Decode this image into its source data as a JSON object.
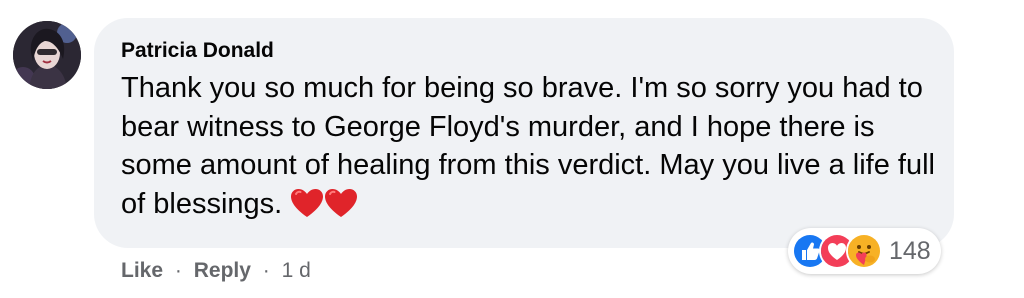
{
  "comment": {
    "author": "Patricia Donald",
    "text": "Thank you so much for being so brave. I'm so sorry you had to bear witness to George Floyd's murder, and I hope there is some amount of healing from this verdict. May you live a life full of blessings.",
    "emojis": [
      "red-heart",
      "red-heart"
    ]
  },
  "actions": {
    "like_label": "Like",
    "separator": "·",
    "reply_label": "Reply",
    "timestamp": "1 d"
  },
  "reactions": {
    "icons": [
      "like-icon",
      "love-icon",
      "care-icon"
    ],
    "count": "148"
  },
  "colors": {
    "bubble": "#f0f2f5",
    "text": "#050505",
    "secondary_text": "#65676b",
    "like_blue": "#1877f2",
    "love_red": "#f33e58",
    "care_yellow": "#f7b125"
  }
}
